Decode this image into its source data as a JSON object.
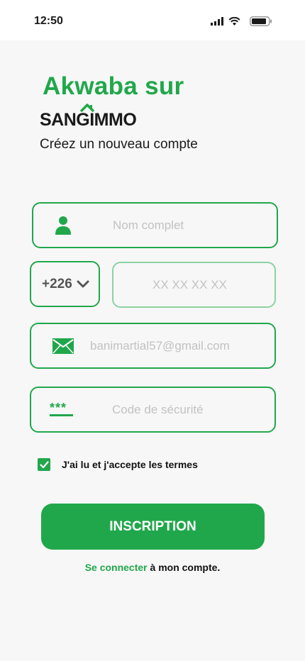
{
  "status_bar": {
    "time": "12:50"
  },
  "header": {
    "greeting": "Akwaba sur",
    "logo_text": "SANGIMMO",
    "subtitle": "Créez un nouveau compte"
  },
  "form": {
    "name_placeholder": "Nom complet",
    "country_code": "+226",
    "phone_placeholder": "XX XX XX XX",
    "email_placeholder": "banimartial57@gmail.com",
    "password_placeholder": "Code de sécurité",
    "terms_label": "J'ai lu et j'accepte les termes",
    "terms_checked": true,
    "submit_label": "INSCRIPTION"
  },
  "footer": {
    "login_link": "Se connecter",
    "login_suffix": " à mon compte."
  },
  "colors": {
    "accent": "#21a74b",
    "placeholder": "#c2c2c2",
    "background": "#f7f7f7"
  },
  "icons": [
    "signal-icon",
    "wifi-icon",
    "battery-icon",
    "user-icon",
    "chevron-down-icon",
    "mail-icon",
    "password-icon",
    "check-icon"
  ]
}
